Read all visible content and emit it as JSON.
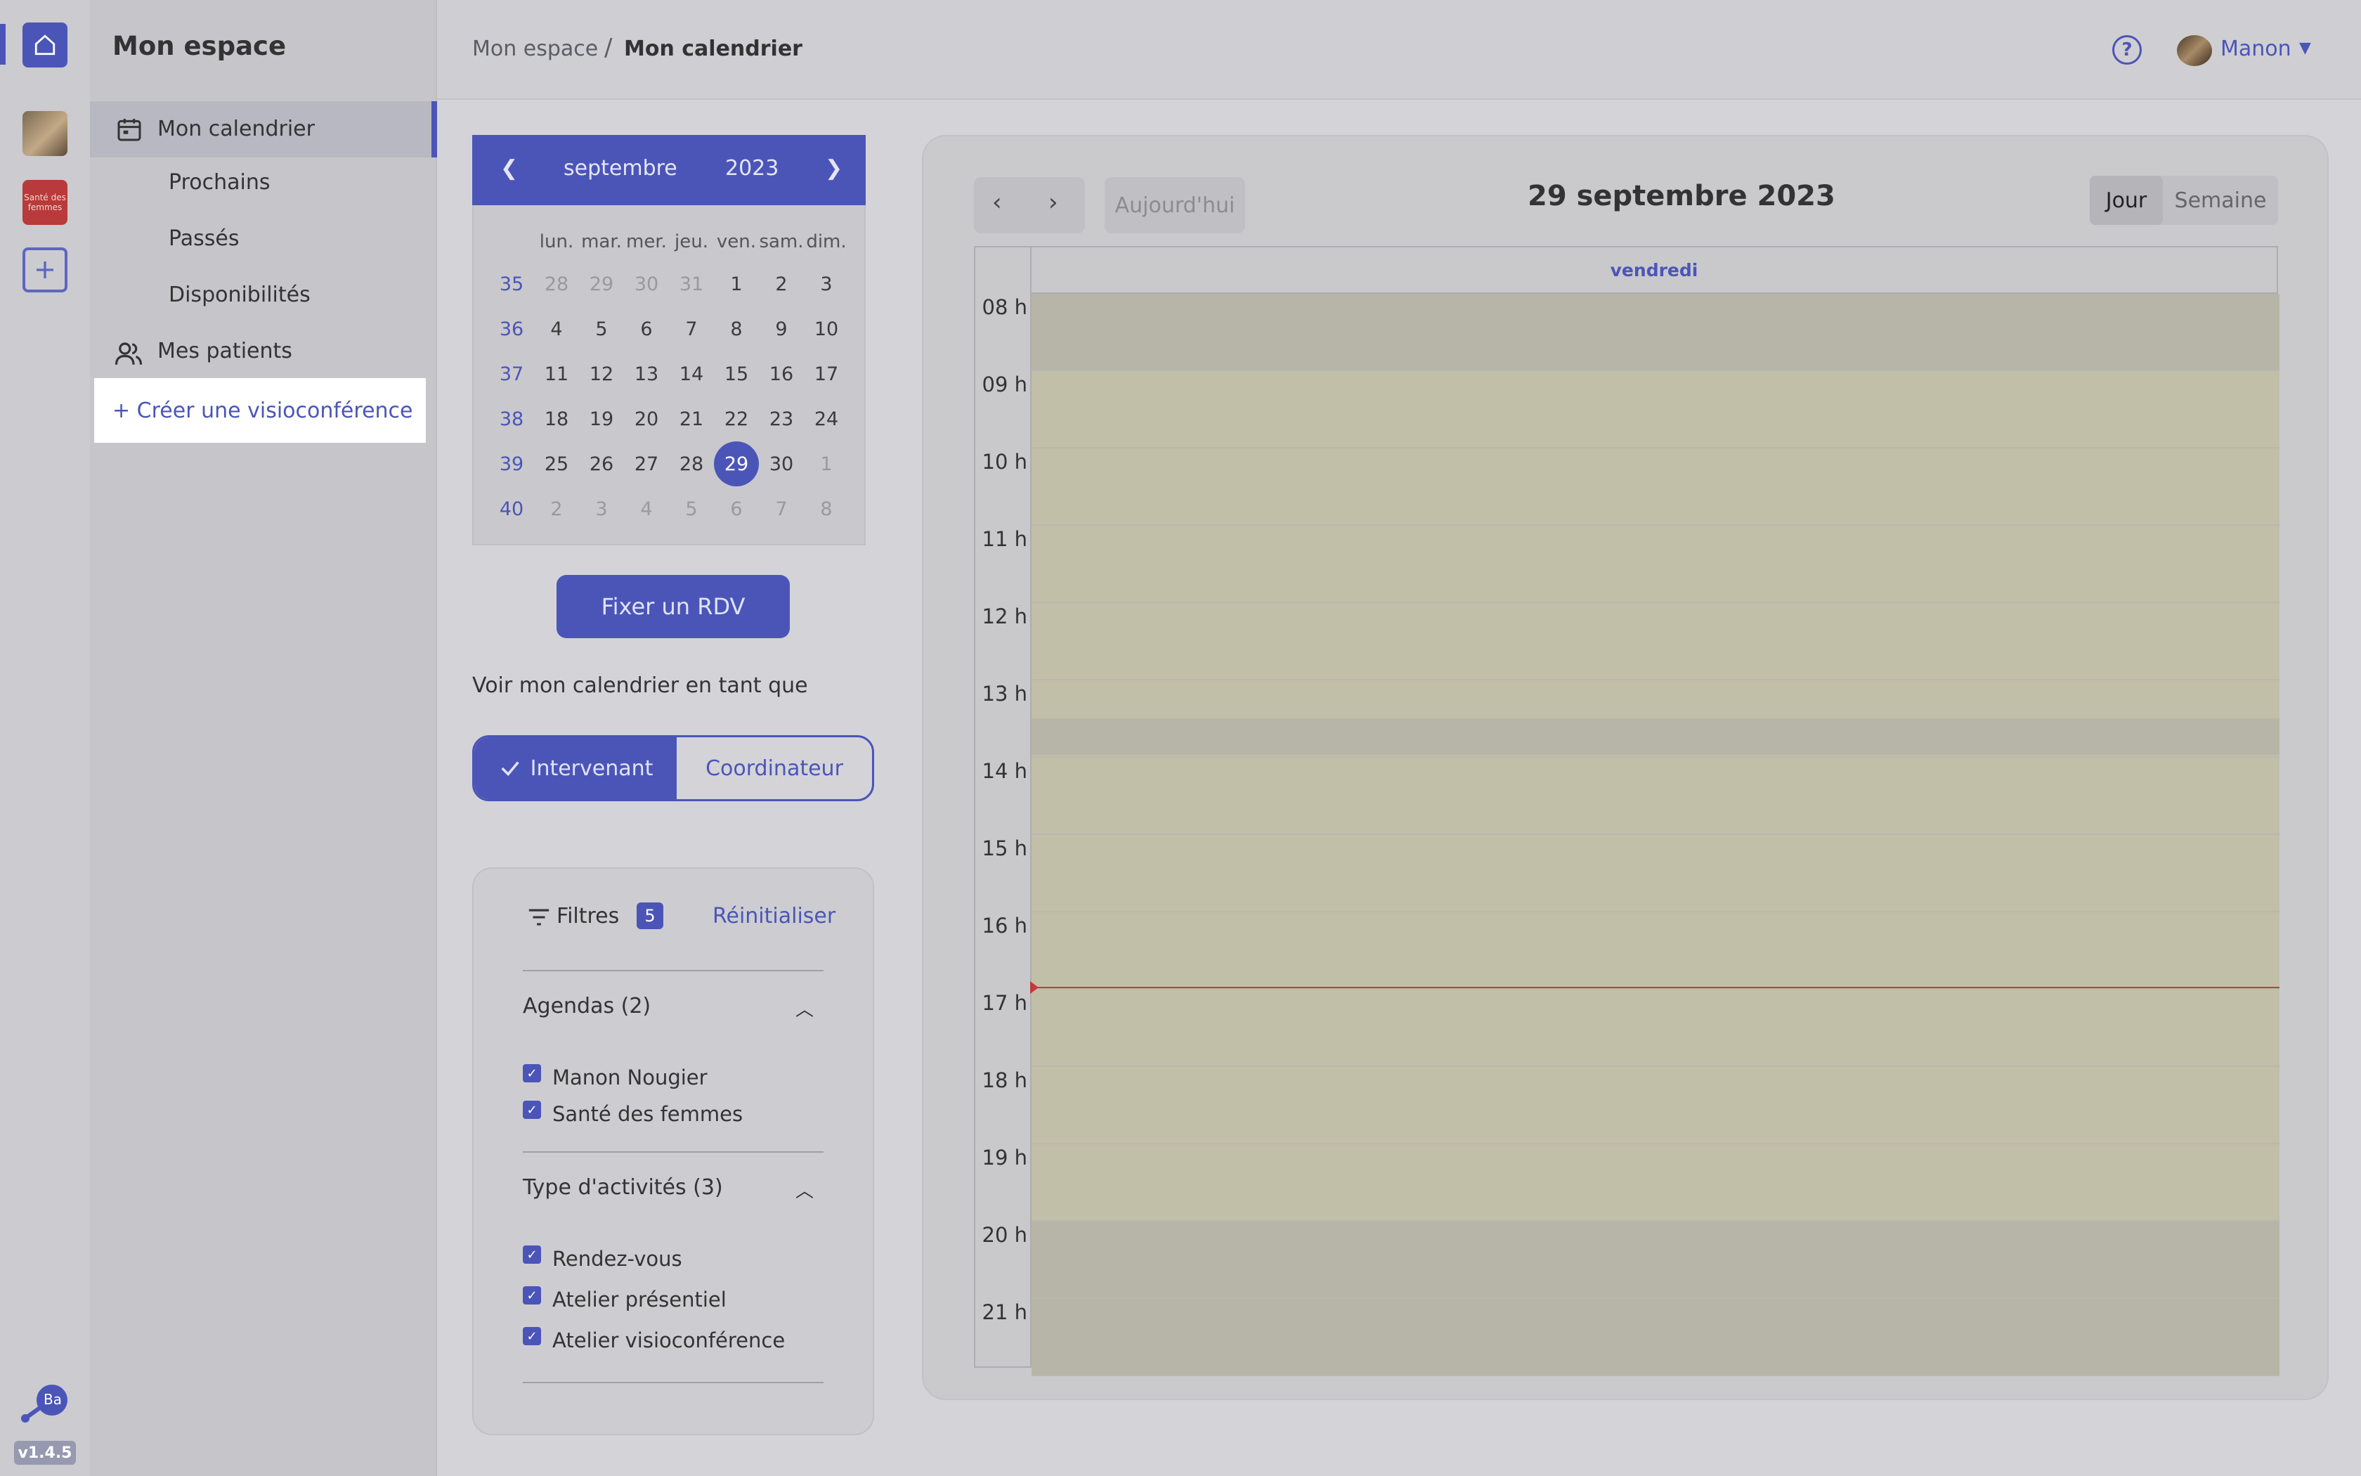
{
  "rail": {
    "version": "v1.4.5",
    "org_logo_text": "Santé des femmes",
    "logo_badge": "Ba"
  },
  "sidebar": {
    "title": "Mon espace",
    "items": [
      {
        "label": "Mon calendrier"
      },
      {
        "label": "Prochains"
      },
      {
        "label": "Passés"
      },
      {
        "label": "Disponibilités"
      },
      {
        "label": "Mes patients"
      }
    ],
    "create_label": "+ Créer une visioconférence"
  },
  "header": {
    "breadcrumb_root": "Mon espace",
    "breadcrumb_sep": "/",
    "breadcrumb_current": "Mon calendrier",
    "help": "?",
    "user_name": "Manon"
  },
  "mini_calendar": {
    "month": "septembre",
    "year": "2023",
    "weekday_headers": [
      "lun.",
      "mar.",
      "mer.",
      "jeu.",
      "ven.",
      "sam.",
      "dim."
    ],
    "weeks": [
      {
        "wk": "35",
        "days": [
          "28",
          "29",
          "30",
          "31",
          "1",
          "2",
          "3"
        ]
      },
      {
        "wk": "36",
        "days": [
          "4",
          "5",
          "6",
          "7",
          "8",
          "9",
          "10"
        ]
      },
      {
        "wk": "37",
        "days": [
          "11",
          "12",
          "13",
          "14",
          "15",
          "16",
          "17"
        ]
      },
      {
        "wk": "38",
        "days": [
          "18",
          "19",
          "20",
          "21",
          "22",
          "23",
          "24"
        ]
      },
      {
        "wk": "39",
        "days": [
          "25",
          "26",
          "27",
          "28",
          "29",
          "30",
          "1"
        ]
      },
      {
        "wk": "40",
        "days": [
          "2",
          "3",
          "4",
          "5",
          "6",
          "7",
          "8"
        ]
      }
    ],
    "selected": "29"
  },
  "actions": {
    "fix_rdv": "Fixer un RDV",
    "view_as": "Voir mon calendrier en tant que",
    "role_selected": "Intervenant",
    "role_other": "Coordinateur"
  },
  "filters": {
    "title": "Filtres",
    "count": "5",
    "reset": "Réinitialiser",
    "agendas_title": "Agendas (2)",
    "agendas": [
      "Manon Nougier",
      "Santé des femmes"
    ],
    "types_title": "Type d'activités (3)",
    "types": [
      "Rendez-vous",
      "Atelier présentiel",
      "Atelier visioconférence"
    ]
  },
  "calendar": {
    "today": "Aujourd'hui",
    "date_title": "29 septembre 2023",
    "view_day": "Jour",
    "view_week": "Semaine",
    "day_name": "vendredi",
    "hours": [
      "08 h",
      "09 h",
      "10 h",
      "11 h",
      "12 h",
      "13 h",
      "14 h",
      "15 h",
      "16 h",
      "17 h",
      "18 h",
      "19 h",
      "20 h",
      "21 h"
    ]
  },
  "colors": {
    "accent": "#4b55b8",
    "now_line": "#c43a3a"
  }
}
